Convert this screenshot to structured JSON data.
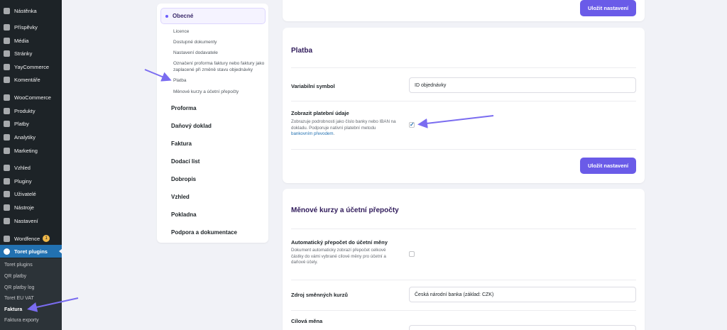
{
  "admin_menu": {
    "items": [
      {
        "label": "Nástěnka",
        "icon": "dashboard-icon"
      },
      {
        "label": "Příspěvky",
        "icon": "pin-icon"
      },
      {
        "label": "Média",
        "icon": "media-icon"
      },
      {
        "label": "Stránky",
        "icon": "pages-icon"
      },
      {
        "label": "YayCommerce",
        "icon": "yaycommerce-icon"
      },
      {
        "label": "Komentáře",
        "icon": "comments-icon"
      },
      {
        "label": "WooCommerce",
        "icon": "woocommerce-icon"
      },
      {
        "label": "Produkty",
        "icon": "products-icon"
      },
      {
        "label": "Platby",
        "icon": "payments-icon"
      },
      {
        "label": "Analytiky",
        "icon": "analytics-icon"
      },
      {
        "label": "Marketing",
        "icon": "marketing-icon"
      },
      {
        "label": "Vzhled",
        "icon": "appearance-icon"
      },
      {
        "label": "Pluginy",
        "icon": "plugins-icon"
      },
      {
        "label": "Uživatelé",
        "icon": "users-icon"
      },
      {
        "label": "Nástroje",
        "icon": "tools-icon"
      },
      {
        "label": "Nastavení",
        "icon": "settings-icon"
      },
      {
        "label": "Wordfence",
        "icon": "wordfence-icon",
        "badge": "1"
      },
      {
        "label": "Toret plugins",
        "icon": "toret-icon"
      }
    ],
    "submenu": [
      {
        "label": "Toret plugins"
      },
      {
        "label": "QR platby"
      },
      {
        "label": "QR platby log"
      },
      {
        "label": "Toret EU VAT"
      },
      {
        "label": "Faktura"
      },
      {
        "label": "Faktura exporty"
      }
    ]
  },
  "settings_nav": {
    "active_section": "Obecné",
    "sub_items": [
      "Licence",
      "Dostupné dokumenty",
      "Nastavení dodavatele",
      "Označení proforma faktury nebo faktury jako zaplacené při změně stavu objednávky",
      "Platba",
      "Měnové kurzy a účetní přepočty"
    ],
    "sections": [
      "Proforma",
      "Daňový doklad",
      "Faktura",
      "Dodací list",
      "Dobropis",
      "Vzhled",
      "Pokladna",
      "Podpora a dokumentace"
    ]
  },
  "top_card": {
    "save_label": "Uložit nastavení"
  },
  "payment_card": {
    "title": "Platba",
    "variable_symbol_label": "Variabilní symbol",
    "variable_symbol_value": "ID objednávky",
    "show_details_label": "Zobrazit platební údaje",
    "show_details_help": "Zobrazuje podrobnosti jako číslo banky nebo IBAN na dokladu. Podporuje nativní platební metodu",
    "show_details_link": "bankovním převodem",
    "show_details_checked": true,
    "save_label": "Uložit nastavení"
  },
  "currency_card": {
    "title": "Měnové kurzy a účetní přepočty",
    "auto_recalc_label": "Automatický přepočet do účetní měny",
    "auto_recalc_help": "Dokument automaticky zobrazí přepočet celkové částky do vámi vybrané cílové měny pro účetní a daňové účely.",
    "auto_recalc_checked": false,
    "rate_source_label": "Zdroj směnných kurzů",
    "rate_source_value": "Česká národní banka (základ: CZK)",
    "target_currency_label": "Cílová měna"
  },
  "colors": {
    "accent": "#6a5be8",
    "sidebar": "#1d2327",
    "active_menu": "#2271b1",
    "arrow": "#7a6cf0"
  }
}
